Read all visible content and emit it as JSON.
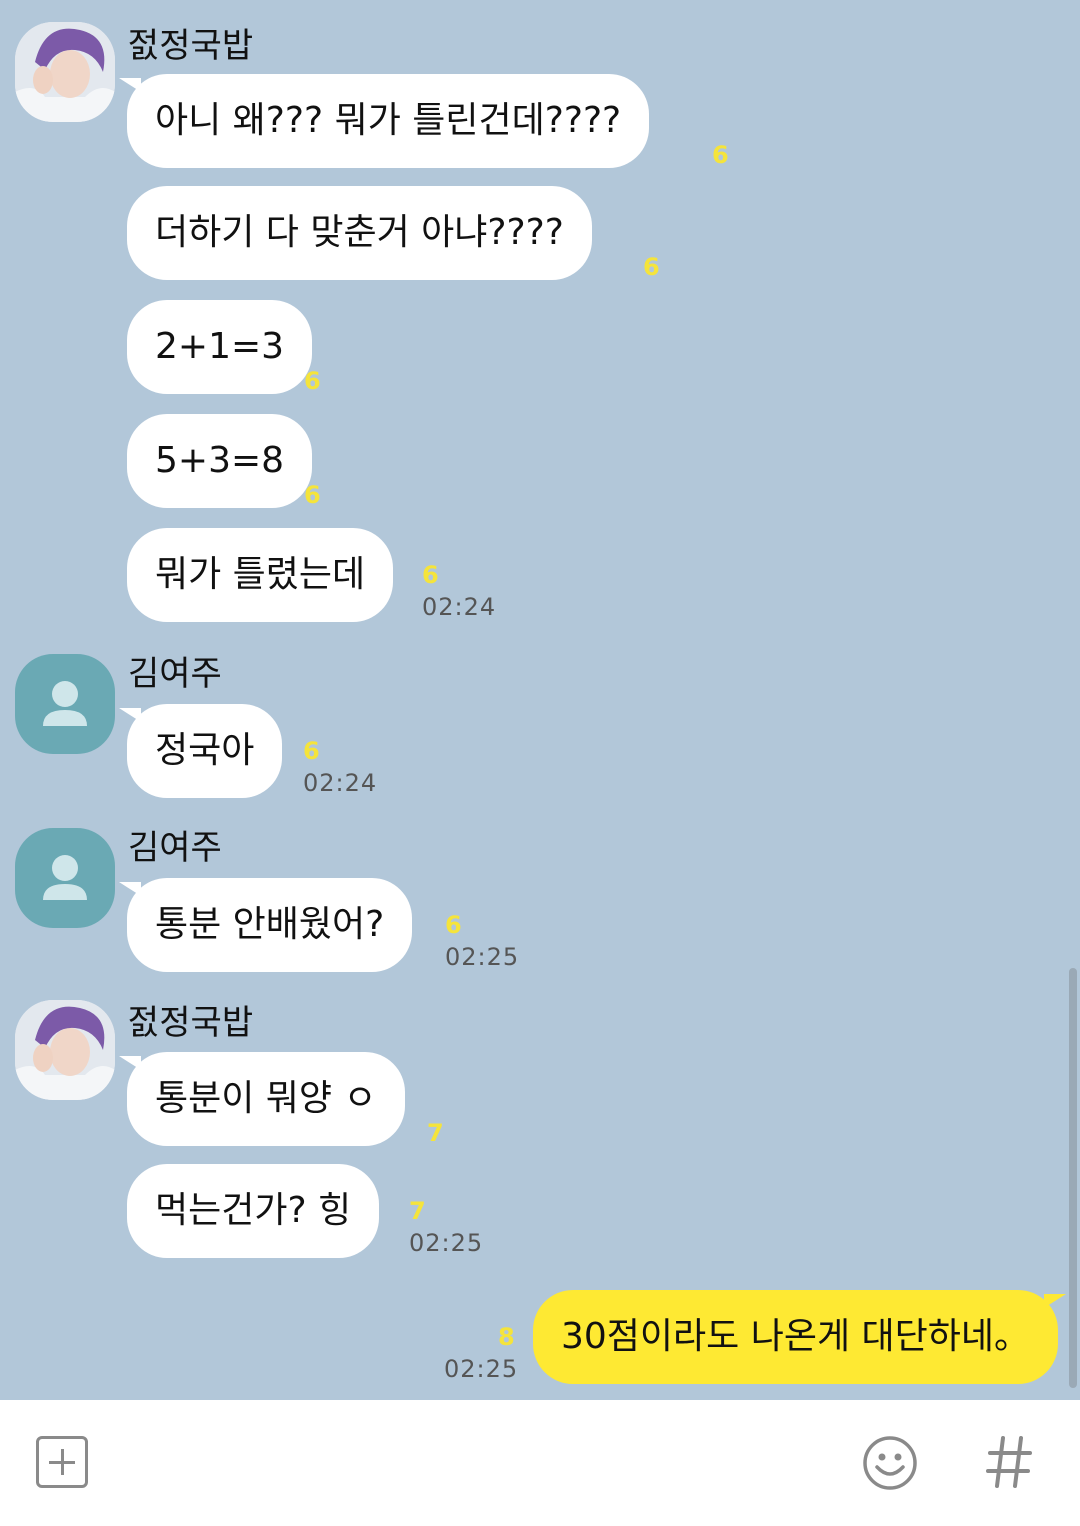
{
  "chat": {
    "groups": [
      {
        "sender": "젌정국밥",
        "avatar": "profile-photo",
        "messages": [
          {
            "text": "아니 왜??? 뭐가 틀린건데????",
            "unread": "6",
            "time": ""
          },
          {
            "text": "더하기 다 맞춘거 아냐????",
            "unread": "6",
            "time": ""
          },
          {
            "text": "2+1=3",
            "unread": "6",
            "time": ""
          },
          {
            "text": "5+3=8",
            "unread": "6",
            "time": ""
          },
          {
            "text": "뭐가 틀렸는데",
            "unread": "6",
            "time": "02:24"
          }
        ]
      },
      {
        "sender": "김여주",
        "avatar": "default-person-icon",
        "messages": [
          {
            "text": "정국아",
            "unread": "6",
            "time": "02:24"
          }
        ]
      },
      {
        "sender": "김여주",
        "avatar": "default-person-icon",
        "messages": [
          {
            "text": "통분 안배웠어?",
            "unread": "6",
            "time": "02:25"
          }
        ]
      },
      {
        "sender": "젌정국밥",
        "avatar": "profile-photo",
        "messages": [
          {
            "text": "통분이 뭐양 ㅇ",
            "unread": "7",
            "time": ""
          },
          {
            "text": "먹는건가? 힝",
            "unread": "7",
            "time": "02:25"
          }
        ]
      }
    ],
    "my_message": {
      "text": "30점이라도 나온게 대단하네。",
      "unread": "8",
      "time": "02:25"
    }
  },
  "input_bar": {
    "attach_icon": "plus-square-icon",
    "emoji_icon": "smiley-icon",
    "hash_icon": "hash-icon",
    "hash_glyph": "#"
  },
  "colors": {
    "background": "#b2c7d9",
    "my_bubble": "#fee933",
    "other_bubble": "#ffffff",
    "unread": "#f5e43b",
    "default_avatar": "#6aa9b4"
  }
}
